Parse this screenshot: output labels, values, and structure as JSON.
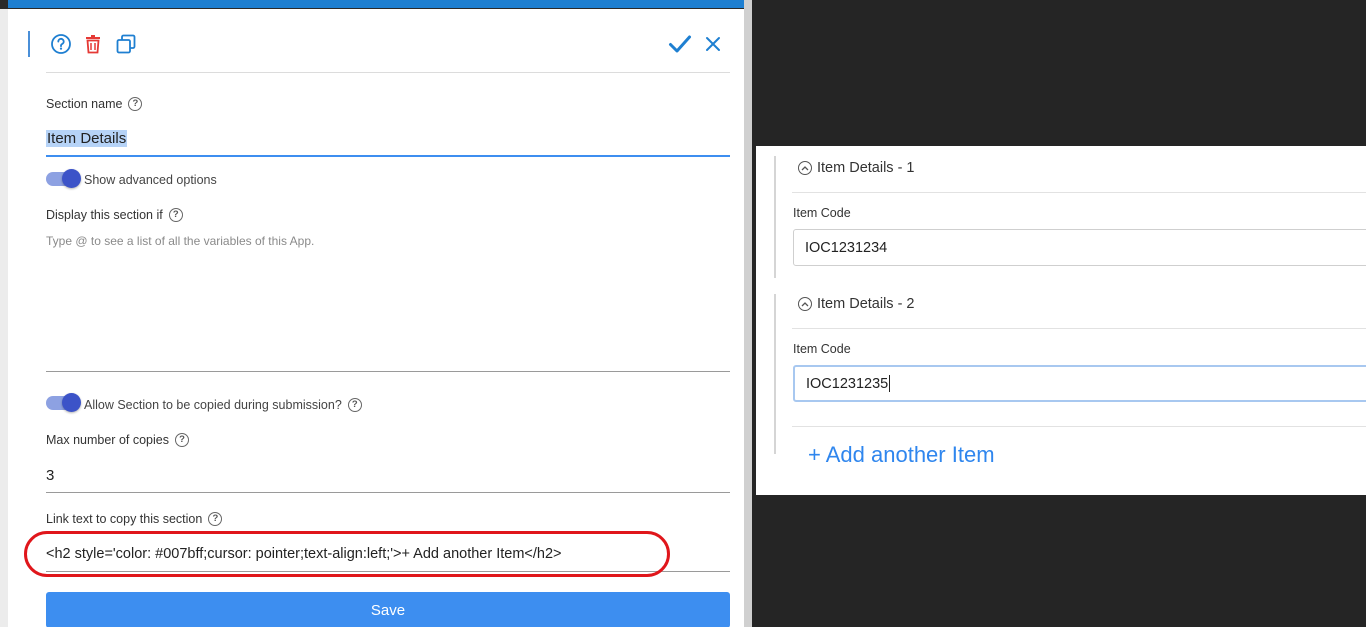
{
  "panel": {
    "toolbar": {
      "help_icon": "question-circle-icon",
      "delete_icon": "trash-icon",
      "duplicate_icon": "copy-icon",
      "confirm_icon": "check-icon",
      "close_icon": "close-icon"
    },
    "section_name_label": "Section name",
    "section_name_value": "Item Details",
    "advanced_toggle_label": "Show advanced options",
    "display_if_label": "Display this section if",
    "display_if_placeholder": "Type @ to see a list of all the variables of this App.",
    "allow_copy_label": "Allow Section to be copied during submission?",
    "max_copies_label": "Max number of copies",
    "max_copies_value": "3",
    "link_text_label": "Link text to copy this section",
    "link_text_value": "<h2 style='color: #007bff;cursor: pointer;text-align:left;'>+ Add another Item</h2>",
    "save_label": "Save"
  },
  "preview": {
    "sections": [
      {
        "title": "Item Details - 1",
        "field_label": "Item Code",
        "field_value": "IOC1231234"
      },
      {
        "title": "Item Details - 2",
        "field_label": "Item Code",
        "field_value": "IOC1231235"
      }
    ],
    "add_link": "+ Add another Item"
  },
  "colors": {
    "accent": "#1e7fd1",
    "save_button": "#3d8ef0",
    "delete_red": "#e53935",
    "highlight": "#e0161b",
    "link_blue": "#2f86ee",
    "toggle": "#3c53c8"
  }
}
